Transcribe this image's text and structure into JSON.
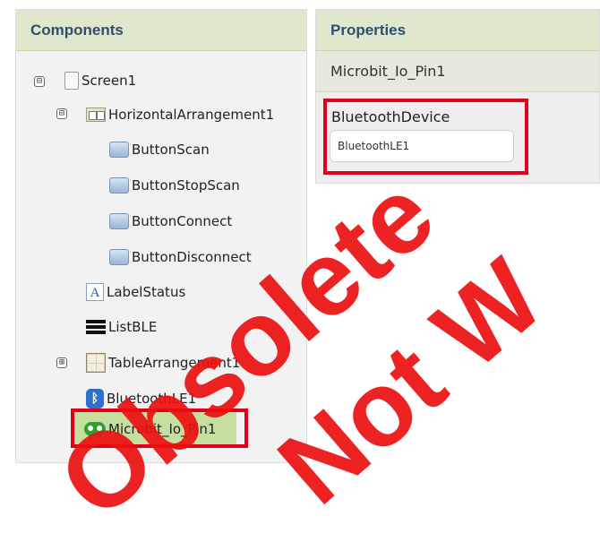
{
  "components": {
    "header": "Components",
    "tree": {
      "screen1": "Screen1",
      "horizontal_arrangement1": "HorizontalArrangement1",
      "button_scan": "ButtonScan",
      "button_stop_scan": "ButtonStopScan",
      "button_connect": "ButtonConnect",
      "button_disconnect": "ButtonDisconnect",
      "label_status": "LabelStatus",
      "list_ble": "ListBLE",
      "table_arrangement1": "TableArrangement1",
      "bluetooth_le1": "BluetoothLE1",
      "microbit_io_pin1": "Microbit_Io_Pin1"
    },
    "toggles": {
      "collapse": "⊟",
      "expand": "⊞"
    },
    "label_icon_glyph": "A",
    "bluetooth_icon_glyph": "ᛒ",
    "selected_item": "Microbit_Io_Pin1"
  },
  "properties": {
    "header": "Properties",
    "component_name": "Microbit_Io_Pin1",
    "fields": [
      {
        "label": "BluetoothDevice",
        "value": "BluetoothLE1"
      }
    ]
  },
  "watermark": {
    "line1": "Obsolete",
    "line2": "Not W",
    "color": "#eb0f0f"
  },
  "highlight_color": "#e0001b"
}
